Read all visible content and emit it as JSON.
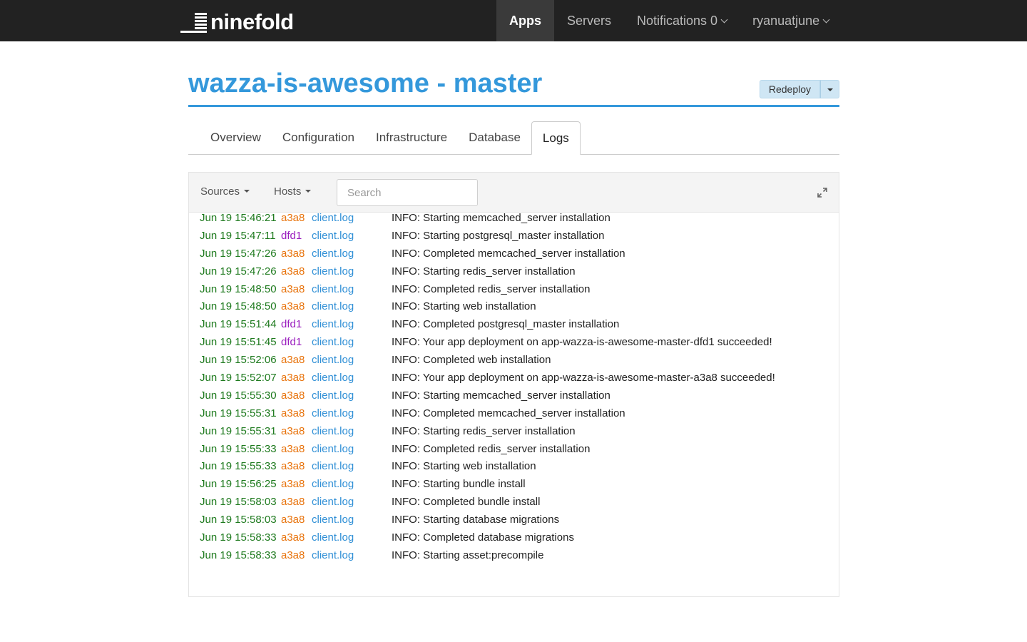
{
  "brand": {
    "name": "ninefold"
  },
  "nav": {
    "items": [
      {
        "label": "Apps",
        "active": true,
        "caret": false
      },
      {
        "label": "Servers",
        "active": false,
        "caret": false
      },
      {
        "label": "Notifications 0",
        "active": false,
        "caret": true
      },
      {
        "label": "ryanuatjune",
        "active": false,
        "caret": true
      }
    ]
  },
  "header": {
    "title": "wazza-is-awesome - master",
    "redeploy_label": "Redeploy"
  },
  "tabs": [
    {
      "label": "Overview",
      "active": false
    },
    {
      "label": "Configuration",
      "active": false
    },
    {
      "label": "Infrastructure",
      "active": false
    },
    {
      "label": "Database",
      "active": false
    },
    {
      "label": "Logs",
      "active": true
    }
  ],
  "logs": {
    "sources_label": "Sources",
    "hosts_label": "Hosts",
    "search_placeholder": "Search",
    "entries": [
      {
        "time": "Jun 19 15:46:21",
        "host": "a3a8",
        "file": "client.log",
        "message": "INFO: Starting memcached_server installation"
      },
      {
        "time": "Jun 19 15:47:11",
        "host": "dfd1",
        "file": "client.log",
        "message": "INFO: Starting postgresql_master installation"
      },
      {
        "time": "Jun 19 15:47:26",
        "host": "a3a8",
        "file": "client.log",
        "message": "INFO: Completed memcached_server installation"
      },
      {
        "time": "Jun 19 15:47:26",
        "host": "a3a8",
        "file": "client.log",
        "message": "INFO: Starting redis_server installation"
      },
      {
        "time": "Jun 19 15:48:50",
        "host": "a3a8",
        "file": "client.log",
        "message": "INFO: Completed redis_server installation"
      },
      {
        "time": "Jun 19 15:48:50",
        "host": "a3a8",
        "file": "client.log",
        "message": "INFO: Starting web installation"
      },
      {
        "time": "Jun 19 15:51:44",
        "host": "dfd1",
        "file": "client.log",
        "message": "INFO: Completed postgresql_master installation"
      },
      {
        "time": "Jun 19 15:51:45",
        "host": "dfd1",
        "file": "client.log",
        "message": "INFO: Your app deployment on app-wazza-is-awesome-master-dfd1 succeeded!"
      },
      {
        "time": "Jun 19 15:52:06",
        "host": "a3a8",
        "file": "client.log",
        "message": "INFO: Completed web installation"
      },
      {
        "time": "Jun 19 15:52:07",
        "host": "a3a8",
        "file": "client.log",
        "message": "INFO: Your app deployment on app-wazza-is-awesome-master-a3a8 succeeded!"
      },
      {
        "time": "Jun 19 15:55:30",
        "host": "a3a8",
        "file": "client.log",
        "message": "INFO: Starting memcached_server installation"
      },
      {
        "time": "Jun 19 15:55:31",
        "host": "a3a8",
        "file": "client.log",
        "message": "INFO: Completed memcached_server installation"
      },
      {
        "time": "Jun 19 15:55:31",
        "host": "a3a8",
        "file": "client.log",
        "message": "INFO: Starting redis_server installation"
      },
      {
        "time": "Jun 19 15:55:33",
        "host": "a3a8",
        "file": "client.log",
        "message": "INFO: Completed redis_server installation"
      },
      {
        "time": "Jun 19 15:55:33",
        "host": "a3a8",
        "file": "client.log",
        "message": "INFO: Starting web installation"
      },
      {
        "time": "Jun 19 15:56:25",
        "host": "a3a8",
        "file": "client.log",
        "message": "INFO: Starting bundle install"
      },
      {
        "time": "Jun 19 15:58:03",
        "host": "a3a8",
        "file": "client.log",
        "message": "INFO: Completed bundle install"
      },
      {
        "time": "Jun 19 15:58:03",
        "host": "a3a8",
        "file": "client.log",
        "message": "INFO: Starting database migrations"
      },
      {
        "time": "Jun 19 15:58:33",
        "host": "a3a8",
        "file": "client.log",
        "message": "INFO: Completed database migrations"
      },
      {
        "time": "Jun 19 15:58:33",
        "host": "a3a8",
        "file": "client.log",
        "message": "INFO: Starting asset:precompile"
      }
    ]
  },
  "colors": {
    "brand_blue": "#3498db",
    "navbar_bg": "#222222",
    "timestamp_green": "#1e7a1e",
    "host_a3a8": "#e8730c",
    "host_dfd1": "#9b1fbf",
    "file_link": "#2f8fd6"
  },
  "icons": {
    "expand": "expand-icon",
    "caret": "caret-down-icon"
  }
}
